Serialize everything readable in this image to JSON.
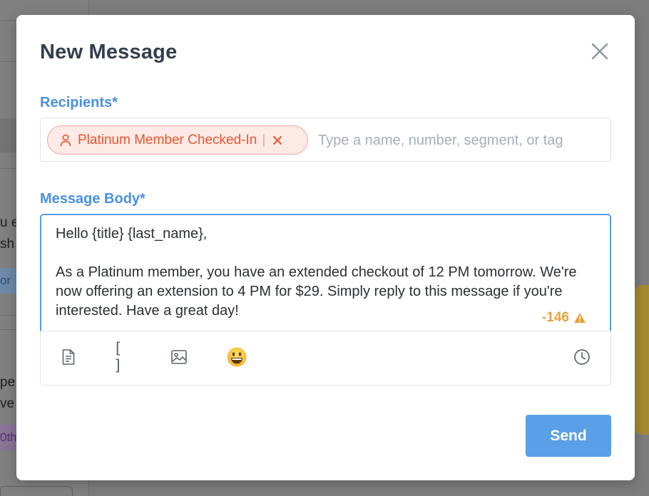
{
  "background": {
    "fragments": [
      "u e",
      "sh",
      "or",
      "pe",
      "ve",
      "0th"
    ]
  },
  "modal": {
    "title": "New Message",
    "recipients": {
      "label": "Recipients*",
      "chip_label": "Platinum Member Checked-In",
      "chip_separator": "|",
      "input_placeholder": "Type a name, number, segment, or tag"
    },
    "message_body": {
      "label": "Message Body*",
      "text": "Hello {title} {last_name},\n\nAs a Platinum member, you have an extended checkout of 12 PM tomorrow. We're now offering an extension to 4 PM for $29. Simply reply to this message if you're interested. Have a great day!",
      "char_count": "-146"
    },
    "toolbar": {
      "icons": [
        "document-icon",
        "brackets-icon",
        "image-icon",
        "emoji-icon",
        "clock-icon"
      ],
      "brackets_glyph": "[ ]"
    },
    "send_label": "Send"
  },
  "colors": {
    "accent": "#4a90e2",
    "title": "#333e4d",
    "chip_text": "#e4572e",
    "chip_bg": "#fde9e6",
    "warning": "#e8a33a",
    "send_bg": "#5aa0e6"
  }
}
